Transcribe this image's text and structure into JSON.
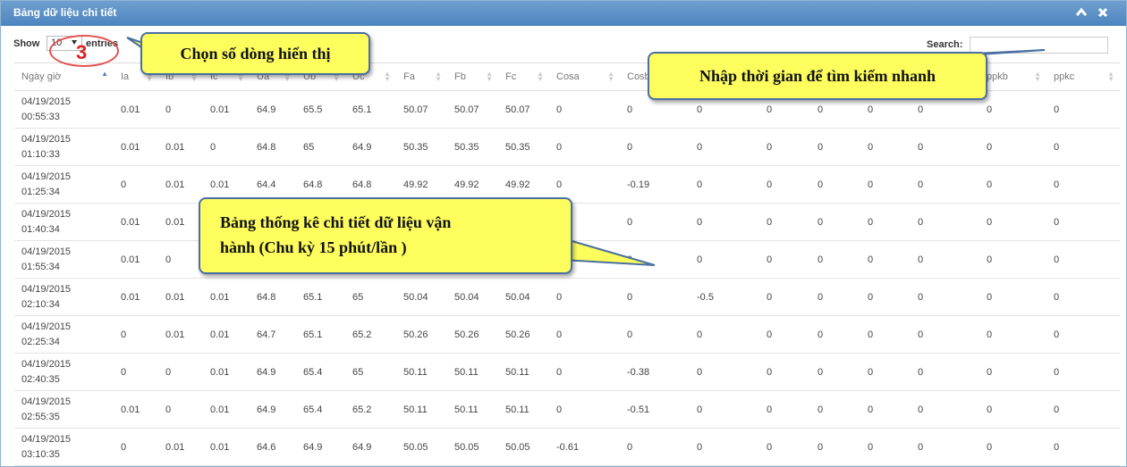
{
  "window": {
    "title": "Bảng dữ liệu chi tiết",
    "collapse_icon": "chevron-up-icon",
    "close_icon": "close-icon"
  },
  "controls": {
    "show_label": "Show",
    "page_size": "10",
    "entries_label": "entries",
    "search_label": "Search:",
    "search_value": ""
  },
  "annotations": {
    "step_number": "3",
    "choose_rows": "Chọn số dòng hiển thị",
    "search_hint": "Nhập thời gian để tìm kiếm nhanh",
    "table_desc_line1": "Bảng thống kê chi tiết dữ liệu vận",
    "table_desc_line2": "hành (Chu kỳ 15 phút/lần )",
    "callout_color": "#fdfd5e"
  },
  "table": {
    "headers": [
      "Ngày giờ",
      "Ia",
      "Ib",
      "Ic",
      "Ua",
      "Ub",
      "Uc",
      "Fa",
      "Fb",
      "Fc",
      "Cosa",
      "Cosb",
      "",
      "",
      "",
      "",
      "",
      "ppkb",
      "ppkc"
    ],
    "rows": [
      [
        "04/19/2015",
        "00:55:33",
        "0.01",
        "0",
        "0.01",
        "64.9",
        "65.5",
        "65.1",
        "50.07",
        "50.07",
        "50.07",
        "0",
        "0",
        "0",
        "0",
        "0",
        "0",
        "0",
        "0",
        "0"
      ],
      [
        "04/19/2015",
        "01:10:33",
        "0.01",
        "0.01",
        "0",
        "64.8",
        "65",
        "64.9",
        "50.35",
        "50.35",
        "50.35",
        "0",
        "0",
        "0",
        "0",
        "0",
        "0",
        "0",
        "0",
        "0"
      ],
      [
        "04/19/2015",
        "01:25:34",
        "0",
        "0.01",
        "0.01",
        "64.4",
        "64.8",
        "64.8",
        "49.92",
        "49.92",
        "49.92",
        "0",
        "-0.19",
        "0",
        "0",
        "0",
        "0",
        "0",
        "0",
        "0"
      ],
      [
        "04/19/2015",
        "01:40:34",
        "0.01",
        "0.01",
        "",
        "",
        "",
        "",
        "",
        "",
        "",
        "",
        "0",
        "0",
        "0",
        "0",
        "0",
        "0",
        "0",
        "0"
      ],
      [
        "04/19/2015",
        "01:55:34",
        "0.01",
        "0",
        "",
        "",
        "",
        "",
        "",
        "",
        "",
        "",
        "0",
        "0",
        "0",
        "0",
        "0",
        "0",
        "0",
        "0"
      ],
      [
        "04/19/2015",
        "02:10:34",
        "0.01",
        "0.01",
        "0.01",
        "64.8",
        "65.1",
        "65",
        "50.04",
        "50.04",
        "50.04",
        "0",
        "0",
        "-0.5",
        "0",
        "0",
        "0",
        "0",
        "0",
        "0"
      ],
      [
        "04/19/2015",
        "02:25:34",
        "0",
        "0.01",
        "0.01",
        "64.7",
        "65.1",
        "65.2",
        "50.26",
        "50.26",
        "50.26",
        "0",
        "0",
        "0",
        "0",
        "0",
        "0",
        "0",
        "0",
        "0"
      ],
      [
        "04/19/2015",
        "02:40:35",
        "0",
        "0",
        "0.01",
        "64.9",
        "65.4",
        "65",
        "50.11",
        "50.11",
        "50.11",
        "0",
        "-0.38",
        "0",
        "0",
        "0",
        "0",
        "0",
        "0",
        "0"
      ],
      [
        "04/19/2015",
        "02:55:35",
        "0.01",
        "0",
        "0.01",
        "64.9",
        "65.4",
        "65.2",
        "50.11",
        "50.11",
        "50.11",
        "0",
        "-0.51",
        "0",
        "0",
        "0",
        "0",
        "0",
        "0",
        "0"
      ],
      [
        "04/19/2015",
        "03:10:35",
        "0",
        "0.01",
        "0.01",
        "64.6",
        "64.9",
        "64.9",
        "50.05",
        "50.05",
        "50.05",
        "-0.61",
        "0",
        "0",
        "0",
        "0",
        "0",
        "0",
        "0",
        "0"
      ]
    ]
  }
}
